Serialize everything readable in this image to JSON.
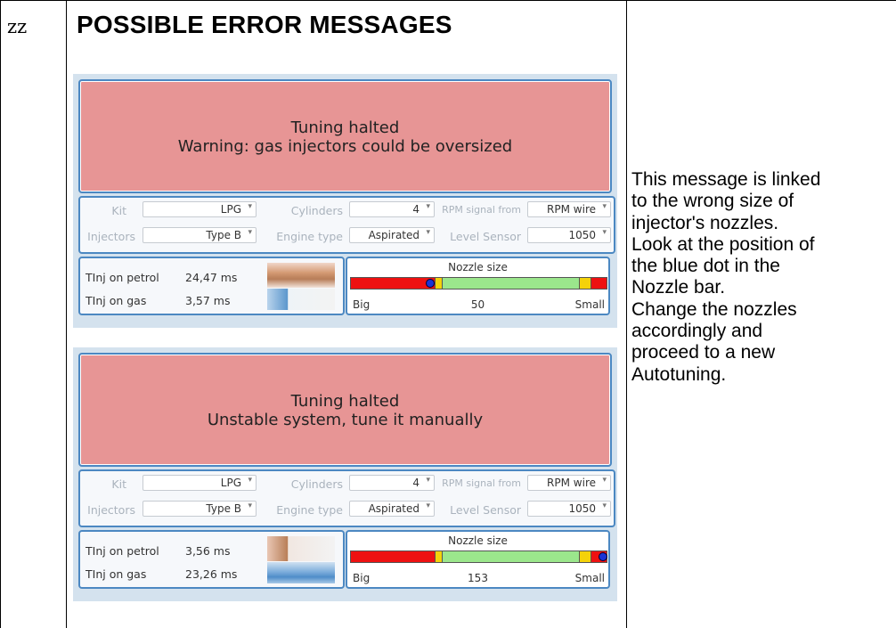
{
  "row_label": "zz",
  "heading": "POSSIBLE ERROR MESSAGES",
  "note_lines": [
    "This message is linked",
    "to the wrong size of",
    "injector's nozzles.",
    "Look at the position of",
    "the blue dot in the",
    "Nozzle bar.",
    "Change the nozzles",
    "accordingly and",
    "proceed to a new",
    "Autotuning."
  ],
  "colors": {
    "alert_bg": "#e79595",
    "border": "#4c88c2",
    "bar_red": "#ee1111",
    "bar_yellow": "#f4d20a",
    "bar_green": "#9be68c",
    "dot": "#1a33d6"
  },
  "panels": [
    {
      "alert_line1": "Tuning halted",
      "alert_line2": "Warning: gas injectors could be oversized",
      "labels": {
        "kit": "Kit",
        "cylinders": "Cylinders",
        "rpm": "RPM signal from",
        "injectors": "Injectors",
        "engine": "Engine type",
        "level": "Level Sensor"
      },
      "values": {
        "kit": "LPG",
        "cylinders": "4",
        "rpm": "RPM wire",
        "injectors": "Type B",
        "engine": "Aspirated",
        "level": "1050"
      },
      "tinj_petrol_label": "TInj on petrol",
      "tinj_petrol": "24,47 ms",
      "tinj_gas_label": "TInj on gas",
      "tinj_gas": "3,57 ms",
      "nozzle_title": "Nozzle size",
      "nozzle_big": "Big",
      "nozzle_value": "50",
      "nozzle_small": "Small",
      "nozzle_position": 0.31
    },
    {
      "alert_line1": "Tuning halted",
      "alert_line2": "Unstable system, tune it manually",
      "labels": {
        "kit": "Kit",
        "cylinders": "Cylinders",
        "rpm": "RPM signal from",
        "injectors": "Injectors",
        "engine": "Engine type",
        "level": "Level Sensor"
      },
      "values": {
        "kit": "LPG",
        "cylinders": "4",
        "rpm": "RPM wire",
        "injectors": "Type B",
        "engine": "Aspirated",
        "level": "1050"
      },
      "tinj_petrol_label": "TInj on petrol",
      "tinj_petrol": "3,56 ms",
      "tinj_gas_label": "TInj on gas",
      "tinj_gas": "23,26 ms",
      "nozzle_title": "Nozzle size",
      "nozzle_big": "Big",
      "nozzle_value": "153",
      "nozzle_small": "Small",
      "nozzle_position": 0.985
    }
  ]
}
